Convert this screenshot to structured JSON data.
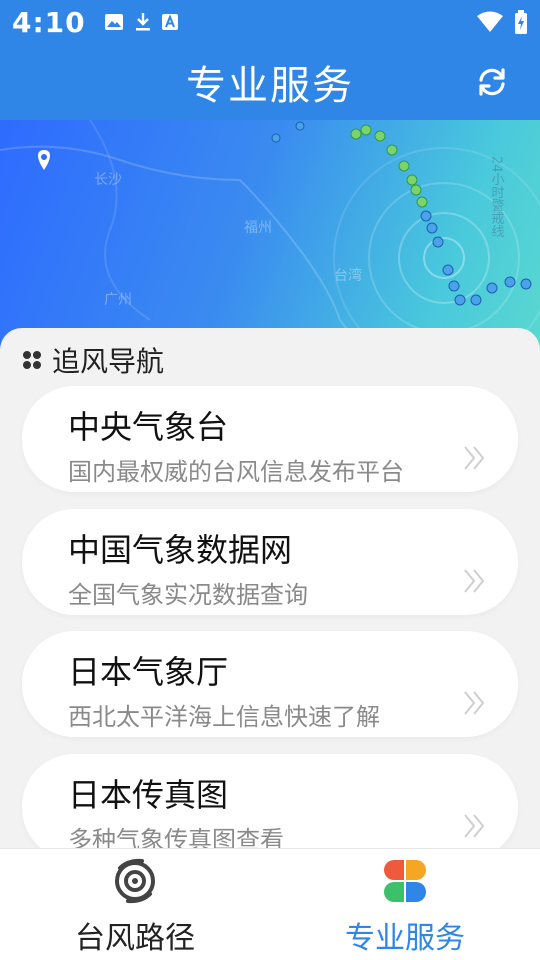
{
  "status_bar": {
    "time": "4:10",
    "left_icons": [
      "image-icon",
      "download-icon",
      "a-notification-icon"
    ],
    "right_icons": [
      "wifi-icon",
      "battery-icon"
    ]
  },
  "header": {
    "title": "专业服务",
    "refresh_icon": "refresh-icon",
    "color": "#2f86e6"
  },
  "map": {
    "labels": [
      "长沙",
      "福州",
      "广州",
      "台湾",
      "24小时警戒线"
    ]
  },
  "section": {
    "title": "追风导航",
    "icon": "grid-dots-icon"
  },
  "cards": [
    {
      "title": "中央气象台",
      "subtitle": "国内最权威的台风信息发布平台"
    },
    {
      "title": "中国气象数据网",
      "subtitle": "全国气象实况数据查询"
    },
    {
      "title": "日本气象厅",
      "subtitle": "西北太平洋海上信息快速了解"
    },
    {
      "title": "日本传真图",
      "subtitle": "多种气象传真图查看"
    }
  ],
  "bottom_nav": {
    "items": [
      {
        "label": "台风路径",
        "icon": "typhoon-icon",
        "active": false
      },
      {
        "label": "专业服务",
        "icon": "four-petal-icon",
        "active": true
      }
    ],
    "active_color": "#2f86e6"
  }
}
